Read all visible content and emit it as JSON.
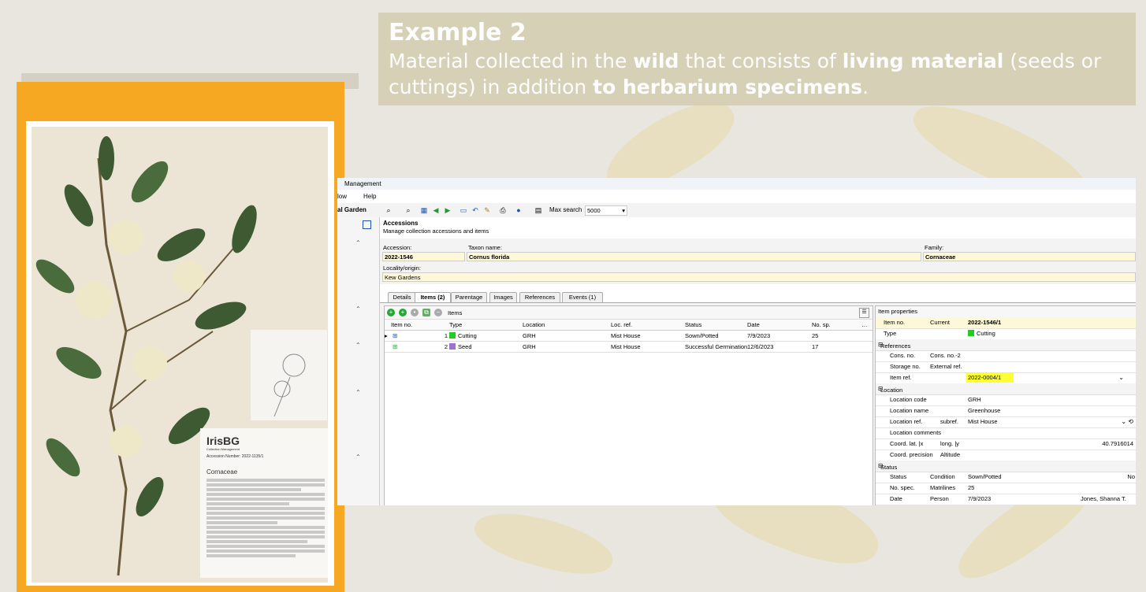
{
  "slide": {
    "title": "Example 2",
    "body_parts": {
      "p1": "Material collected in the ",
      "b1": "wild",
      "p2": " that consists of ",
      "b2": "living material",
      "p3": " (seeds or cuttings) in addition ",
      "b3": "to herbarium specimens",
      "p4": "."
    }
  },
  "specimen_label": {
    "logo": "IrisBG",
    "logo_sub": "Collection Management",
    "accession": "Accession Number: 2022-1135/1",
    "family": "Cornaceae"
  },
  "app": {
    "title": "Management",
    "menu": [
      "low",
      "Help"
    ],
    "garden": "al Garden",
    "max_search_label": "Max search",
    "max_search_value": "5000",
    "header_title": "Accessions",
    "header_subtitle": "Manage collection accessions and items",
    "fields": {
      "accession_label": "Accession:",
      "accession_value": "2022-1546",
      "taxon_label": "Taxon name:",
      "taxon_value": "Cornus florida",
      "family_label": "Family:",
      "family_value": "Cornaceae",
      "locality_label": "Locality/origin:",
      "locality_value": "Kew Gardens"
    },
    "tabs": [
      "Details",
      "Items (2)",
      "Parentage",
      "Images",
      "References",
      "Events (1)"
    ],
    "grid": {
      "title": "Items",
      "columns": [
        "Item no.",
        "Type",
        "Location",
        "Loc. ref.",
        "Status",
        "Date",
        "No. sp."
      ],
      "rows": [
        {
          "no": "1",
          "type": "Cutting",
          "type_color": "#22cc22",
          "location": "GRH",
          "locref": "Mist House",
          "status": "Sown/Potted",
          "date": "7/9/2023",
          "nsp": "25"
        },
        {
          "no": "2",
          "type": "Seed",
          "type_color": "#a070d0",
          "location": "GRH",
          "locref": "Mist House",
          "status": "Successful Germination",
          "date": "12/6/2023",
          "nsp": "17"
        }
      ]
    },
    "props": {
      "title": "Item properties",
      "item_no_label": "Item no.",
      "item_no_current": "Current",
      "item_no_value": "2022-1546/1",
      "type_label": "Type",
      "type_value": "Cutting",
      "sec_references": "References",
      "cons_no": "Cons. no.",
      "cons_no2": "Cons. no.-2",
      "storage_no": "Storage no.",
      "external_ref": "External ref.",
      "item_ref_label": "Item ref.",
      "item_ref_value": "2022-0004/1",
      "sec_location": "Location",
      "loc_code_label": "Location code",
      "loc_code_value": "GRH",
      "loc_name_label": "Location name",
      "loc_name_value": "Greenhouse",
      "loc_ref_label": "Location ref.",
      "subref_label": "subref.",
      "loc_ref_value": "Mist House",
      "loc_comments": "Location comments",
      "coord_lat": "Coord. lat. |x",
      "long": "long. |y",
      "long_value": "40.7916014",
      "coord_precision": "Coord. precision",
      "altitude": "Altitude",
      "sec_status": "Status",
      "status_label": "Status",
      "condition_label": "Condition",
      "status_value": "Sown/Potted",
      "no_trunc": "No",
      "no_spec_label": "No. spec.",
      "matrilines": "Matrilines",
      "no_spec_value": "25",
      "date_label": "Date",
      "person_label": "Person",
      "date_value": "7/9/2023",
      "person_value": "Jones, Shanna T."
    }
  }
}
